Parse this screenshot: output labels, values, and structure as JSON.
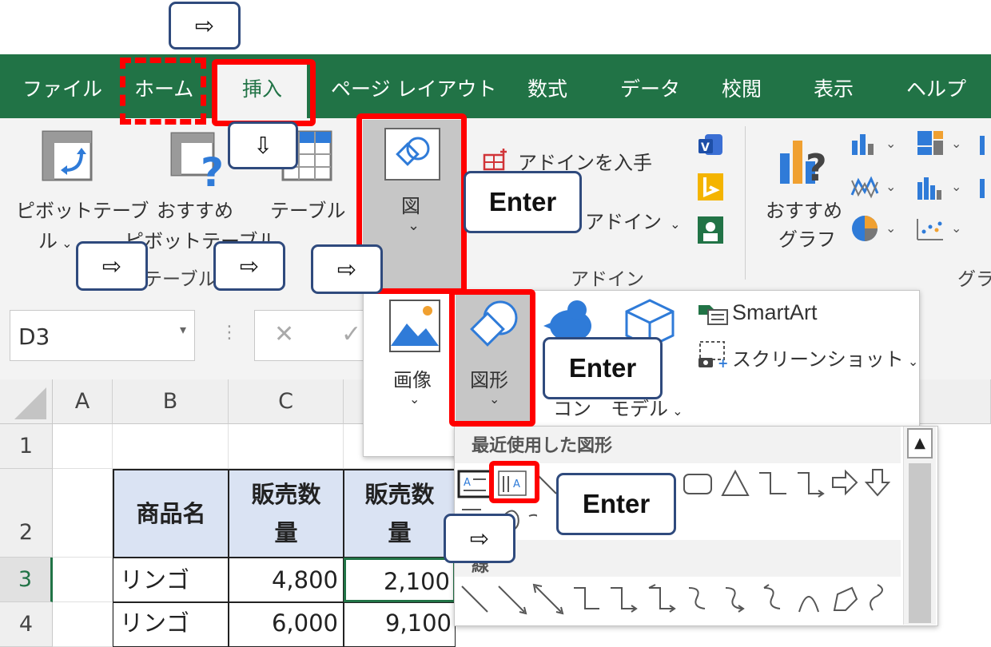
{
  "tabs": [
    "ファイル",
    "ホーム",
    "挿入",
    "ページ レイアウト",
    "数式",
    "データ",
    "校閲",
    "表示",
    "ヘルプ"
  ],
  "ribbon": {
    "pivot_line1": "ピボットテーブ",
    "pivot_line2": "ル",
    "rec_pivot_line1": "おすすめ",
    "rec_pivot_line2": "ピボットテーブル",
    "table": "テーブル",
    "group_table": "テーブル",
    "illustrations": "図",
    "get_addins": "アドインを入手",
    "my_addins": "アドイン",
    "group_addins": "アドイン",
    "rec_charts_line1": "おすすめ",
    "rec_charts_line2": "グラフ",
    "group_charts": "グラ"
  },
  "formula_bar": {
    "name_box": "D3"
  },
  "dropdown": {
    "picture": "画像",
    "shapes": "図形",
    "icons": "コン",
    "models": "モデル",
    "smartart": "SmartArt",
    "screenshot": "スクリーンショット"
  },
  "shapes_panel": {
    "recent_title": "最近使用した図形",
    "lines_title": "線"
  },
  "grid": {
    "columns": [
      "A",
      "B",
      "C"
    ],
    "rows": [
      "1",
      "2",
      "3",
      "4"
    ],
    "header": [
      "商品名",
      "販売数量",
      "販売数量"
    ],
    "header_b": "商品名",
    "header_c_l1": "販売数",
    "header_c_l2": "量",
    "header_d_l1": "販売数",
    "header_d_l2": "量",
    "r3": [
      "リンゴ",
      "4,800",
      "2,100"
    ],
    "r4": [
      "リンゴ",
      "6,000",
      "9,100"
    ]
  },
  "callouts": {
    "arrow_right": "⇨",
    "arrow_down": "⇩",
    "enter": "Enter"
  },
  "colors": {
    "excel_green": "#217346",
    "highlight_red": "#ff0000",
    "callout_border": "#2f4a7d",
    "header_fill": "#dae3f3"
  }
}
